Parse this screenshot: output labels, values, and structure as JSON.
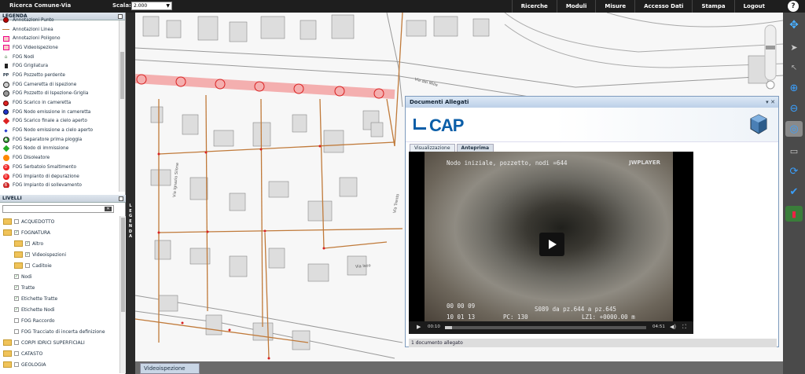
{
  "topbar": {
    "title": "Ricerca Comune-Via",
    "scala_label": "Scala:",
    "scala_value": "2.000",
    "menu": [
      "Ricerche",
      "Moduli",
      "Misure",
      "Accesso Dati",
      "Stampa",
      "Logout"
    ],
    "help": "?"
  },
  "legend": {
    "header": "LEGENDA",
    "items": [
      {
        "label": "Annotazioni Punto",
        "icon": "red-circle-icon"
      },
      {
        "label": "Annotazioni Linea",
        "icon": "brown-line-icon"
      },
      {
        "label": "Annotazioni Poligono",
        "icon": "pink-square-icon"
      },
      {
        "label": "FOG Videoispezione",
        "icon": "pink-square-icon"
      },
      {
        "label": "FOG Nodi",
        "icon": "nodes-group-icon"
      },
      {
        "label": "FOG Grigliatura",
        "icon": "grate-icon"
      },
      {
        "label": "FOG Pozzetto perdente",
        "icon": "pp-icon"
      },
      {
        "label": "FOG Cameretta di ispezione",
        "icon": "grey-circle-icon"
      },
      {
        "label": "FOG Pozzetto di Ispezione-Griglia",
        "icon": "grey-grid-circle-icon"
      },
      {
        "label": "FOG Scarico in cameretta",
        "icon": "red-dot-icon"
      },
      {
        "label": "FOG Nodo emissione in cameretta",
        "icon": "blue-dot-icon"
      },
      {
        "label": "FOG Scarico finale a cielo aperto",
        "icon": "red-diamond-icon"
      },
      {
        "label": "FOG Nodo emissione a cielo aperto",
        "icon": "small-blue-diamond-icon"
      },
      {
        "label": "FOG Separatore prima pioggia",
        "icon": "green-triangle-icon"
      },
      {
        "label": "FOG Nodo di immissione",
        "icon": "green-diamond-icon"
      },
      {
        "label": "FOG Disoleatore",
        "icon": "orange-circle-icon"
      },
      {
        "label": "FOG Serbatoio Smaltimento",
        "icon": "d-circle-icon"
      },
      {
        "label": "FOG Impianto di depurazione",
        "icon": "d-circle-icon"
      },
      {
        "label": "FOG Impianto di sollevamento",
        "icon": "b-circle-icon"
      }
    ],
    "side_tab": "LEGENDA"
  },
  "livelli": {
    "header": "LIVELLI",
    "search_placeholder": "",
    "tree": [
      {
        "label": "ACQUEDOTTO",
        "level": 0,
        "type": "folder",
        "checked": false
      },
      {
        "label": "FOGNATURA",
        "level": 0,
        "type": "folder",
        "checked": true
      },
      {
        "label": "Altro",
        "level": 1,
        "type": "folder",
        "checked": true
      },
      {
        "label": "Videoispezioni",
        "level": 1,
        "type": "folder",
        "checked": true
      },
      {
        "label": "Caditoie",
        "level": 1,
        "type": "folder",
        "checked": false
      },
      {
        "label": "Nodi",
        "level": 1,
        "type": "leaf",
        "checked": true
      },
      {
        "label": "Tratte",
        "level": 1,
        "type": "leaf",
        "checked": true
      },
      {
        "label": "Etichette Tratte",
        "level": 1,
        "type": "leaf",
        "checked": true
      },
      {
        "label": "Etichette Nodi",
        "level": 1,
        "type": "leaf",
        "checked": true
      },
      {
        "label": "FOG Raccordo",
        "level": 1,
        "type": "leaf",
        "checked": false
      },
      {
        "label": "FOG Tracciato di incerta definizione",
        "level": 1,
        "type": "leaf",
        "checked": false
      },
      {
        "label": "CORPI IDRICI SUPERFICIALI",
        "level": 0,
        "type": "folder",
        "checked": false
      },
      {
        "label": "CATASTO",
        "level": 0,
        "type": "folder",
        "checked": false
      },
      {
        "label": "GEOLOGIA",
        "level": 0,
        "type": "folder",
        "checked": false
      }
    ]
  },
  "map": {
    "street_labels": [
      "Via dei Mille",
      "Via Iseo",
      "Via Trento",
      "Via Ignazio Silone"
    ]
  },
  "docwin": {
    "title": "Documenti Allegati",
    "logo": "CAP",
    "tabs": [
      "Visualizzazione",
      "Anteprima"
    ],
    "active_tab": "Anteprima",
    "video": {
      "overlay_top": "Nodo iniziale, pozzetto, nodi =644",
      "brand": "JWPLAYER",
      "overlay_time1": "00 00 09",
      "overlay_date": "10 01 13",
      "overlay_pc": "PC: 130",
      "overlay_seg": "S089 da pz.644 a pz.645",
      "overlay_lz": "LZ1: +0000.00 m",
      "time_elapsed": "00:10",
      "time_total": "04:51",
      "progress": 0.035
    },
    "status": "1 documento allegato"
  },
  "bottombar": {
    "tab_label": "Videoispezione"
  },
  "colors": {
    "topbar": "#1e1e1e",
    "pipe": "#c07a3a",
    "highlight": "#f3a6a6",
    "node": "#d92020",
    "brand": "#0b5ea8"
  }
}
